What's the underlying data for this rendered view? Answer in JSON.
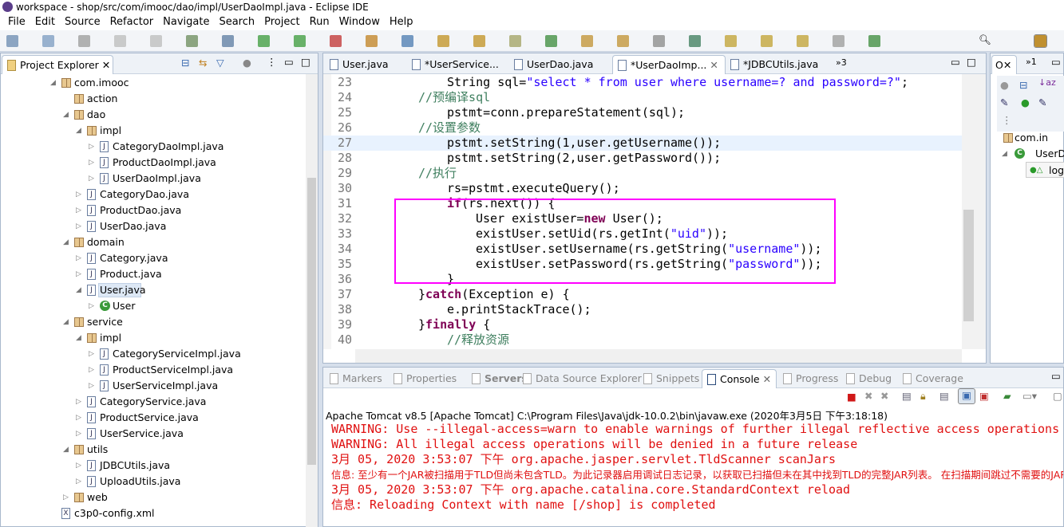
{
  "window": {
    "title": "workspace - shop/src/com/imooc/dao/impl/UserDaoImpl.java - Eclipse IDE"
  },
  "menu": [
    "File",
    "Edit",
    "Source",
    "Refactor",
    "Navigate",
    "Search",
    "Project",
    "Run",
    "Window",
    "Help"
  ],
  "explorer": {
    "title": "Project Explorer",
    "items": [
      {
        "label": "com.imooc",
        "level": 0,
        "icon": "package-icon",
        "arrow": "expanded"
      },
      {
        "label": "action",
        "level": 1,
        "icon": "package-icon",
        "arrow": ""
      },
      {
        "label": "dao",
        "level": 1,
        "icon": "package-icon",
        "arrow": "expanded"
      },
      {
        "label": "impl",
        "level": 2,
        "icon": "package-icon",
        "arrow": "expanded"
      },
      {
        "label": "CategoryDaoImpl.java",
        "level": 3,
        "icon": "java-file-icon",
        "arrow": "collapsed"
      },
      {
        "label": "ProductDaoImpl.java",
        "level": 3,
        "icon": "java-file-icon",
        "arrow": "collapsed"
      },
      {
        "label": "UserDaoImpl.java",
        "level": 3,
        "icon": "java-file-icon",
        "arrow": "collapsed"
      },
      {
        "label": "CategoryDao.java",
        "level": 2,
        "icon": "java-file-icon",
        "arrow": "collapsed"
      },
      {
        "label": "ProductDao.java",
        "level": 2,
        "icon": "java-file-icon",
        "arrow": "collapsed"
      },
      {
        "label": "UserDao.java",
        "level": 2,
        "icon": "java-file-icon",
        "arrow": "collapsed"
      },
      {
        "label": "domain",
        "level": 1,
        "icon": "package-icon",
        "arrow": "expanded"
      },
      {
        "label": "Category.java",
        "level": 2,
        "icon": "java-file-icon",
        "arrow": "collapsed"
      },
      {
        "label": "Product.java",
        "level": 2,
        "icon": "java-file-icon",
        "arrow": "collapsed"
      },
      {
        "label": "User.java",
        "level": 2,
        "icon": "java-file-icon",
        "arrow": "expanded",
        "selected": true
      },
      {
        "label": "User",
        "level": 3,
        "icon": "class-icon",
        "arrow": "collapsed"
      },
      {
        "label": "service",
        "level": 1,
        "icon": "package-icon",
        "arrow": "expanded"
      },
      {
        "label": "impl",
        "level": 2,
        "icon": "package-icon",
        "arrow": "expanded"
      },
      {
        "label": "CategoryServiceImpl.java",
        "level": 3,
        "icon": "java-file-icon",
        "arrow": "collapsed"
      },
      {
        "label": "ProductServiceImpl.java",
        "level": 3,
        "icon": "java-file-icon",
        "arrow": "collapsed"
      },
      {
        "label": "UserServiceImpl.java",
        "level": 3,
        "icon": "java-file-icon",
        "arrow": "collapsed"
      },
      {
        "label": "CategoryService.java",
        "level": 2,
        "icon": "java-file-icon",
        "arrow": "collapsed"
      },
      {
        "label": "ProductService.java",
        "level": 2,
        "icon": "java-file-icon",
        "arrow": "collapsed"
      },
      {
        "label": "UserService.java",
        "level": 2,
        "icon": "java-file-icon",
        "arrow": "collapsed"
      },
      {
        "label": "utils",
        "level": 1,
        "icon": "package-icon",
        "arrow": "expanded"
      },
      {
        "label": "JDBCUtils.java",
        "level": 2,
        "icon": "java-file-icon",
        "arrow": "collapsed"
      },
      {
        "label": "UploadUtils.java",
        "level": 2,
        "icon": "java-file-icon",
        "arrow": "collapsed"
      },
      {
        "label": "web",
        "level": 1,
        "icon": "package-icon",
        "arrow": "collapsed"
      },
      {
        "label": "c3p0-config.xml",
        "level": 0,
        "icon": "xml-file-icon",
        "arrow": ""
      }
    ]
  },
  "editor": {
    "tabs": [
      "User.java",
      "*UserService...",
      "UserDao.java",
      "*UserDaoImp...",
      "*JDBCUtils.java"
    ],
    "active_tab": 3,
    "overflow": "»3",
    "lines": [
      {
        "n": "23",
        "indent": 3,
        "t": [
          [
            "",
            "String sql="
          ],
          [
            "str",
            "\"select * from user where username=? and password=?\""
          ],
          [
            "",
            ";"
          ]
        ]
      },
      {
        "n": "24",
        "indent": 2,
        "t": [
          [
            "cm",
            "//预编译sql"
          ]
        ]
      },
      {
        "n": "25",
        "indent": 3,
        "t": [
          [
            "",
            "pstmt=conn.prepareStatement(sql);"
          ]
        ]
      },
      {
        "n": "26",
        "indent": 2,
        "t": [
          [
            "cm",
            "//设置参数"
          ]
        ]
      },
      {
        "n": "27",
        "indent": 3,
        "t": [
          [
            "",
            "pstmt.setString(1,user.getUsername());"
          ]
        ],
        "current": true
      },
      {
        "n": "28",
        "indent": 3,
        "t": [
          [
            "",
            "pstmt.setString(2,user.getPassword());"
          ]
        ]
      },
      {
        "n": "29",
        "indent": 2,
        "t": [
          [
            "cm",
            "//执行"
          ]
        ]
      },
      {
        "n": "30",
        "indent": 3,
        "t": [
          [
            "",
            "rs=pstmt.executeQuery();"
          ]
        ]
      },
      {
        "n": "31",
        "indent": 3,
        "t": [
          [
            "kw",
            "if"
          ],
          [
            "",
            "(rs.next()) {"
          ]
        ]
      },
      {
        "n": "32",
        "indent": 4,
        "t": [
          [
            "",
            "User existUser="
          ],
          [
            "kw",
            "new"
          ],
          [
            "",
            " User();"
          ]
        ]
      },
      {
        "n": "33",
        "indent": 4,
        "t": [
          [
            "",
            "existUser.setUid(rs.getInt("
          ],
          [
            "str",
            "\"uid\""
          ],
          [
            "",
            "));"
          ]
        ]
      },
      {
        "n": "34",
        "indent": 4,
        "t": [
          [
            "",
            "existUser.setUsername(rs.getString("
          ],
          [
            "str",
            "\"username\""
          ],
          [
            "",
            "));"
          ]
        ]
      },
      {
        "n": "35",
        "indent": 4,
        "t": [
          [
            "",
            "existUser.setPassword(rs.getString("
          ],
          [
            "str",
            "\"password\""
          ],
          [
            "",
            "));"
          ]
        ]
      },
      {
        "n": "36",
        "indent": 3,
        "t": [
          [
            "",
            "}"
          ]
        ]
      },
      {
        "n": "37",
        "indent": 2,
        "t": [
          [
            "",
            "}"
          ],
          [
            "kw",
            "catch"
          ],
          [
            "",
            "(Exception e) {"
          ]
        ]
      },
      {
        "n": "38",
        "indent": 3,
        "t": [
          [
            "",
            "e.printStackTrace();"
          ]
        ]
      },
      {
        "n": "39",
        "indent": 2,
        "t": [
          [
            "",
            "}"
          ],
          [
            "kw",
            "finally"
          ],
          [
            "",
            " {"
          ]
        ]
      },
      {
        "n": "40",
        "indent": 3,
        "t": [
          [
            "cm",
            "//释放资源"
          ]
        ]
      }
    ],
    "highlight_color": "#ff00ff"
  },
  "outline": {
    "tab": "O",
    "overflow": "»1",
    "items": [
      "com.in",
      "UserD",
      "logi"
    ]
  },
  "bottom": {
    "tabs": [
      "Markers",
      "Properties",
      "Servers",
      "Data Source Explorer",
      "Snippets",
      "Console",
      "Progress",
      "Debug",
      "Coverage"
    ],
    "active_tab": 5,
    "console_header": "Apache Tomcat v8.5 [Apache Tomcat] C:\\Program Files\\Java\\jdk-10.0.2\\bin\\javaw.exe (2020年3月5日 下午3:18:18)",
    "console_lines": [
      "WARNING: Use --illegal-access=warn to enable warnings of further illegal reflective access operations",
      "WARNING: All illegal access operations will be denied in a future release",
      "3月 05, 2020 3:53:07 下午 org.apache.jasper.servlet.TldScanner scanJars",
      "信息: 至少有一个JAR被扫描用于TLD但尚未包含TLD。为此记录器启用调试日志记录，以获取已扫描但未在其中找到TLD的完整JAR列表。 在扫描期间跳过不需要的JAR",
      "3月 05, 2020 3:53:07 下午 org.apache.catalina.core.StandardContext reload",
      "信息: Reloading Context with name [/shop] is completed"
    ],
    "error_color": "#e01010"
  }
}
